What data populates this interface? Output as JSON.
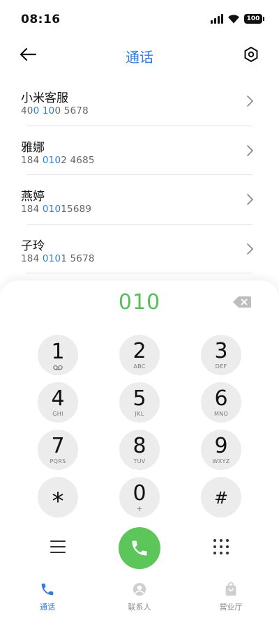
{
  "status_bar": {
    "time": "08:16",
    "battery": "100"
  },
  "header": {
    "title": "通话",
    "back_icon": "arrow-left-icon",
    "settings_icon": "hexagon-settings-icon"
  },
  "contacts": [
    {
      "name": "小米客服",
      "number_parts": [
        "40",
        "0 10",
        "0 5678"
      ]
    },
    {
      "name": "雅娜",
      "number_parts": [
        "184 ",
        "010",
        "2 4685"
      ]
    },
    {
      "name": "燕婷",
      "number_parts": [
        "184 ",
        "010",
        "15689"
      ]
    },
    {
      "name": "子玲",
      "number_parts": [
        "184 ",
        "010",
        "1 5678"
      ]
    }
  ],
  "dialpad": {
    "dialed_number": "010",
    "keys": [
      {
        "digit": "1",
        "letters": ""
      },
      {
        "digit": "2",
        "letters": "ABC"
      },
      {
        "digit": "3",
        "letters": "DEF"
      },
      {
        "digit": "4",
        "letters": "GHI"
      },
      {
        "digit": "5",
        "letters": "JKL"
      },
      {
        "digit": "6",
        "letters": "MNO"
      },
      {
        "digit": "7",
        "letters": "PQRS"
      },
      {
        "digit": "8",
        "letters": "TUV"
      },
      {
        "digit": "9",
        "letters": "WXYZ"
      },
      {
        "digit": "*",
        "letters": ""
      },
      {
        "digit": "0",
        "letters": "+"
      },
      {
        "digit": "#",
        "letters": ""
      }
    ]
  },
  "bottom_nav": {
    "tabs": [
      {
        "label": "通话",
        "icon": "phone-icon",
        "active": true
      },
      {
        "label": "联系人",
        "icon": "person-icon",
        "active": false
      },
      {
        "label": "营业厅",
        "icon": "shopping-bag-icon",
        "active": false
      }
    ]
  },
  "colors": {
    "accent_blue": "#2f7de1",
    "call_green": "#5cc65a",
    "dialed_green": "#58be5c",
    "key_background": "#ececec"
  }
}
